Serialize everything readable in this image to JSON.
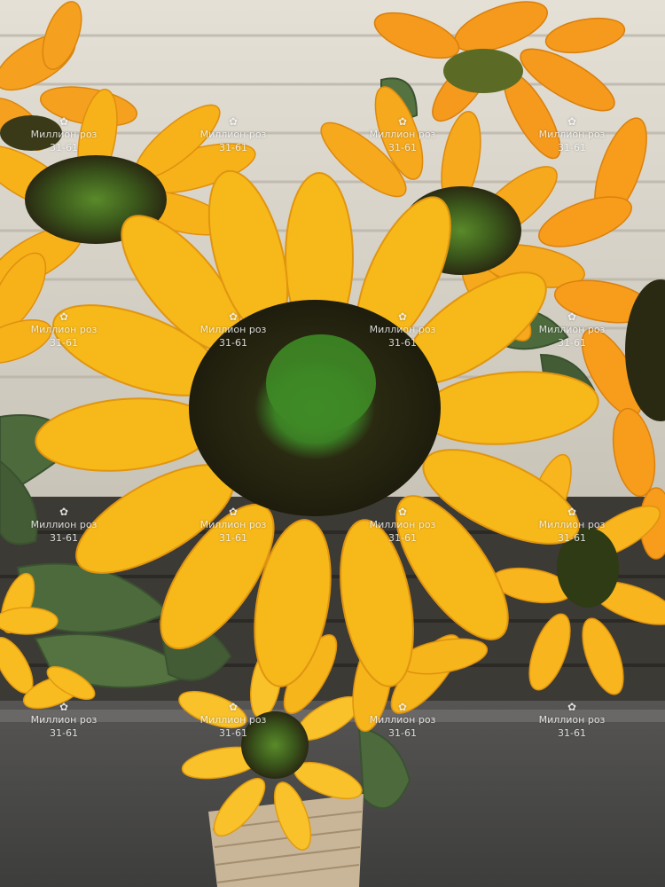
{
  "watermark": {
    "icon": "rose-icon",
    "line1": "Миллион роз",
    "line2": "31-61"
  },
  "colors": {
    "petal": "#f7b819",
    "petal_dark": "#ec9a0c",
    "orange_petal": "#f59a1c",
    "disc_dark": "#2c2a12",
    "disc_center": "#3d8a25",
    "leaf": "#4d6a3d",
    "shutter": "#d9d4c8",
    "pavement": "#4b4b4a",
    "basket": "#c9b597"
  }
}
